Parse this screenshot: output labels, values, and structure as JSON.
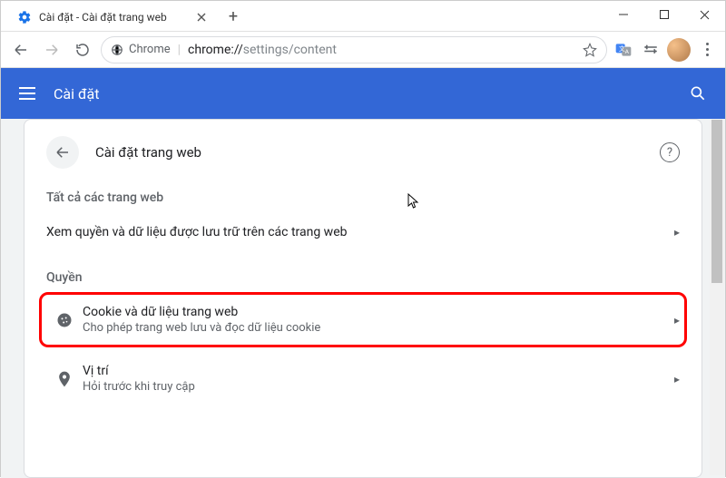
{
  "window": {
    "tab_title": "Cài đặt - Cài đặt trang web"
  },
  "omnibox": {
    "secure_label": "Chrome",
    "url_dark": "chrome://",
    "url_light": "settings/content"
  },
  "header": {
    "title": "Cài đặt"
  },
  "card": {
    "title": "Cài đặt trang web",
    "section_all": "Tất cả các trang web",
    "row_all_sites": "Xem quyền và dữ liệu được lưu trữ trên các trang web",
    "section_perm": "Quyền",
    "cookies": {
      "title": "Cookie và dữ liệu trang web",
      "subtitle": "Cho phép trang web lưu và đọc dữ liệu cookie"
    },
    "location": {
      "title": "Vị trí",
      "subtitle": "Hỏi trước khi truy cập"
    }
  }
}
